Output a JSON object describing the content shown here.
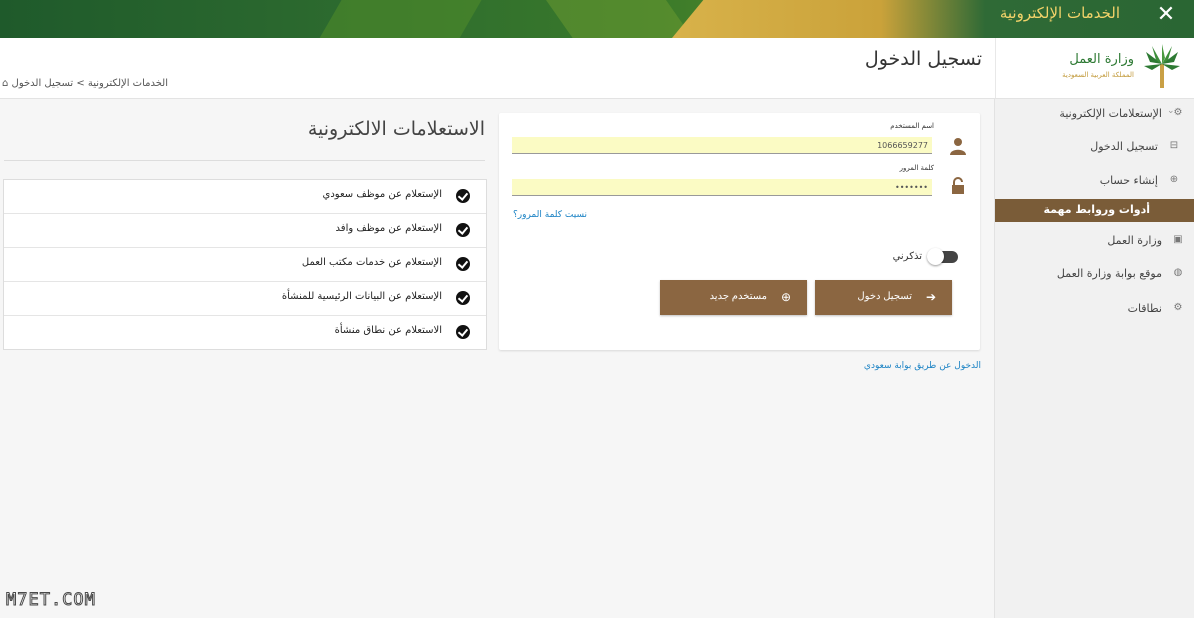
{
  "topbar": {
    "title": "الخدمات الإلكترونية",
    "close_icon": "close-icon"
  },
  "header": {
    "logo_name": "وزارة العمل",
    "logo_sub": "المملكة العربية السعودية",
    "page_title": "تسجيل الدخول",
    "breadcrumb": "الخدمات الإلكترونية > تسجيل الدخول",
    "breadcrumb_icon": "home-icon"
  },
  "sidebar": {
    "items": [
      {
        "label": "الإستعلامات الإلكترونية",
        "icon": "cogs-icon"
      },
      {
        "label": "تسجيل الدخول",
        "icon": "sign-in-icon"
      },
      {
        "label": "إنشاء حساب",
        "icon": "plus-circle-icon"
      },
      {
        "label": "أدوات وروابط مهمة",
        "icon": ""
      },
      {
        "label": "وزارة العمل",
        "icon": "building-icon"
      },
      {
        "label": "موقع بوابة وزارة العمل",
        "icon": "globe-icon"
      },
      {
        "label": "نطاقات",
        "icon": "gear-icon"
      }
    ],
    "active_index": 3,
    "accent_color": "#7a5c38"
  },
  "login": {
    "username_label": "اسم المستخدم",
    "username_value": "1066659277",
    "password_label": "كلمة المرور",
    "password_value": "•••••••",
    "forgot_link": "نسيت كلمة المرور؟",
    "remember_label": "تذكرني",
    "remember_on": false,
    "login_button": "تسجيل دخول",
    "new_user_button": "مستخدم جديد",
    "button_color": "#8b6641"
  },
  "saudi_portal_link": "الدخول عن طريق بوابة سعودي",
  "inquiries": {
    "title": "الاستعلامات الالكترونية",
    "items": [
      "الإستعلام عن موظف سعودي",
      "الإستعلام عن موظف وافد",
      "الإستعلام عن خدمات مكتب العمل",
      "الإستعلام عن البيانات الرئيسية للمنشأة",
      "الاستعلام عن نطاق منشأة"
    ]
  },
  "watermark": "M7ET.COM"
}
